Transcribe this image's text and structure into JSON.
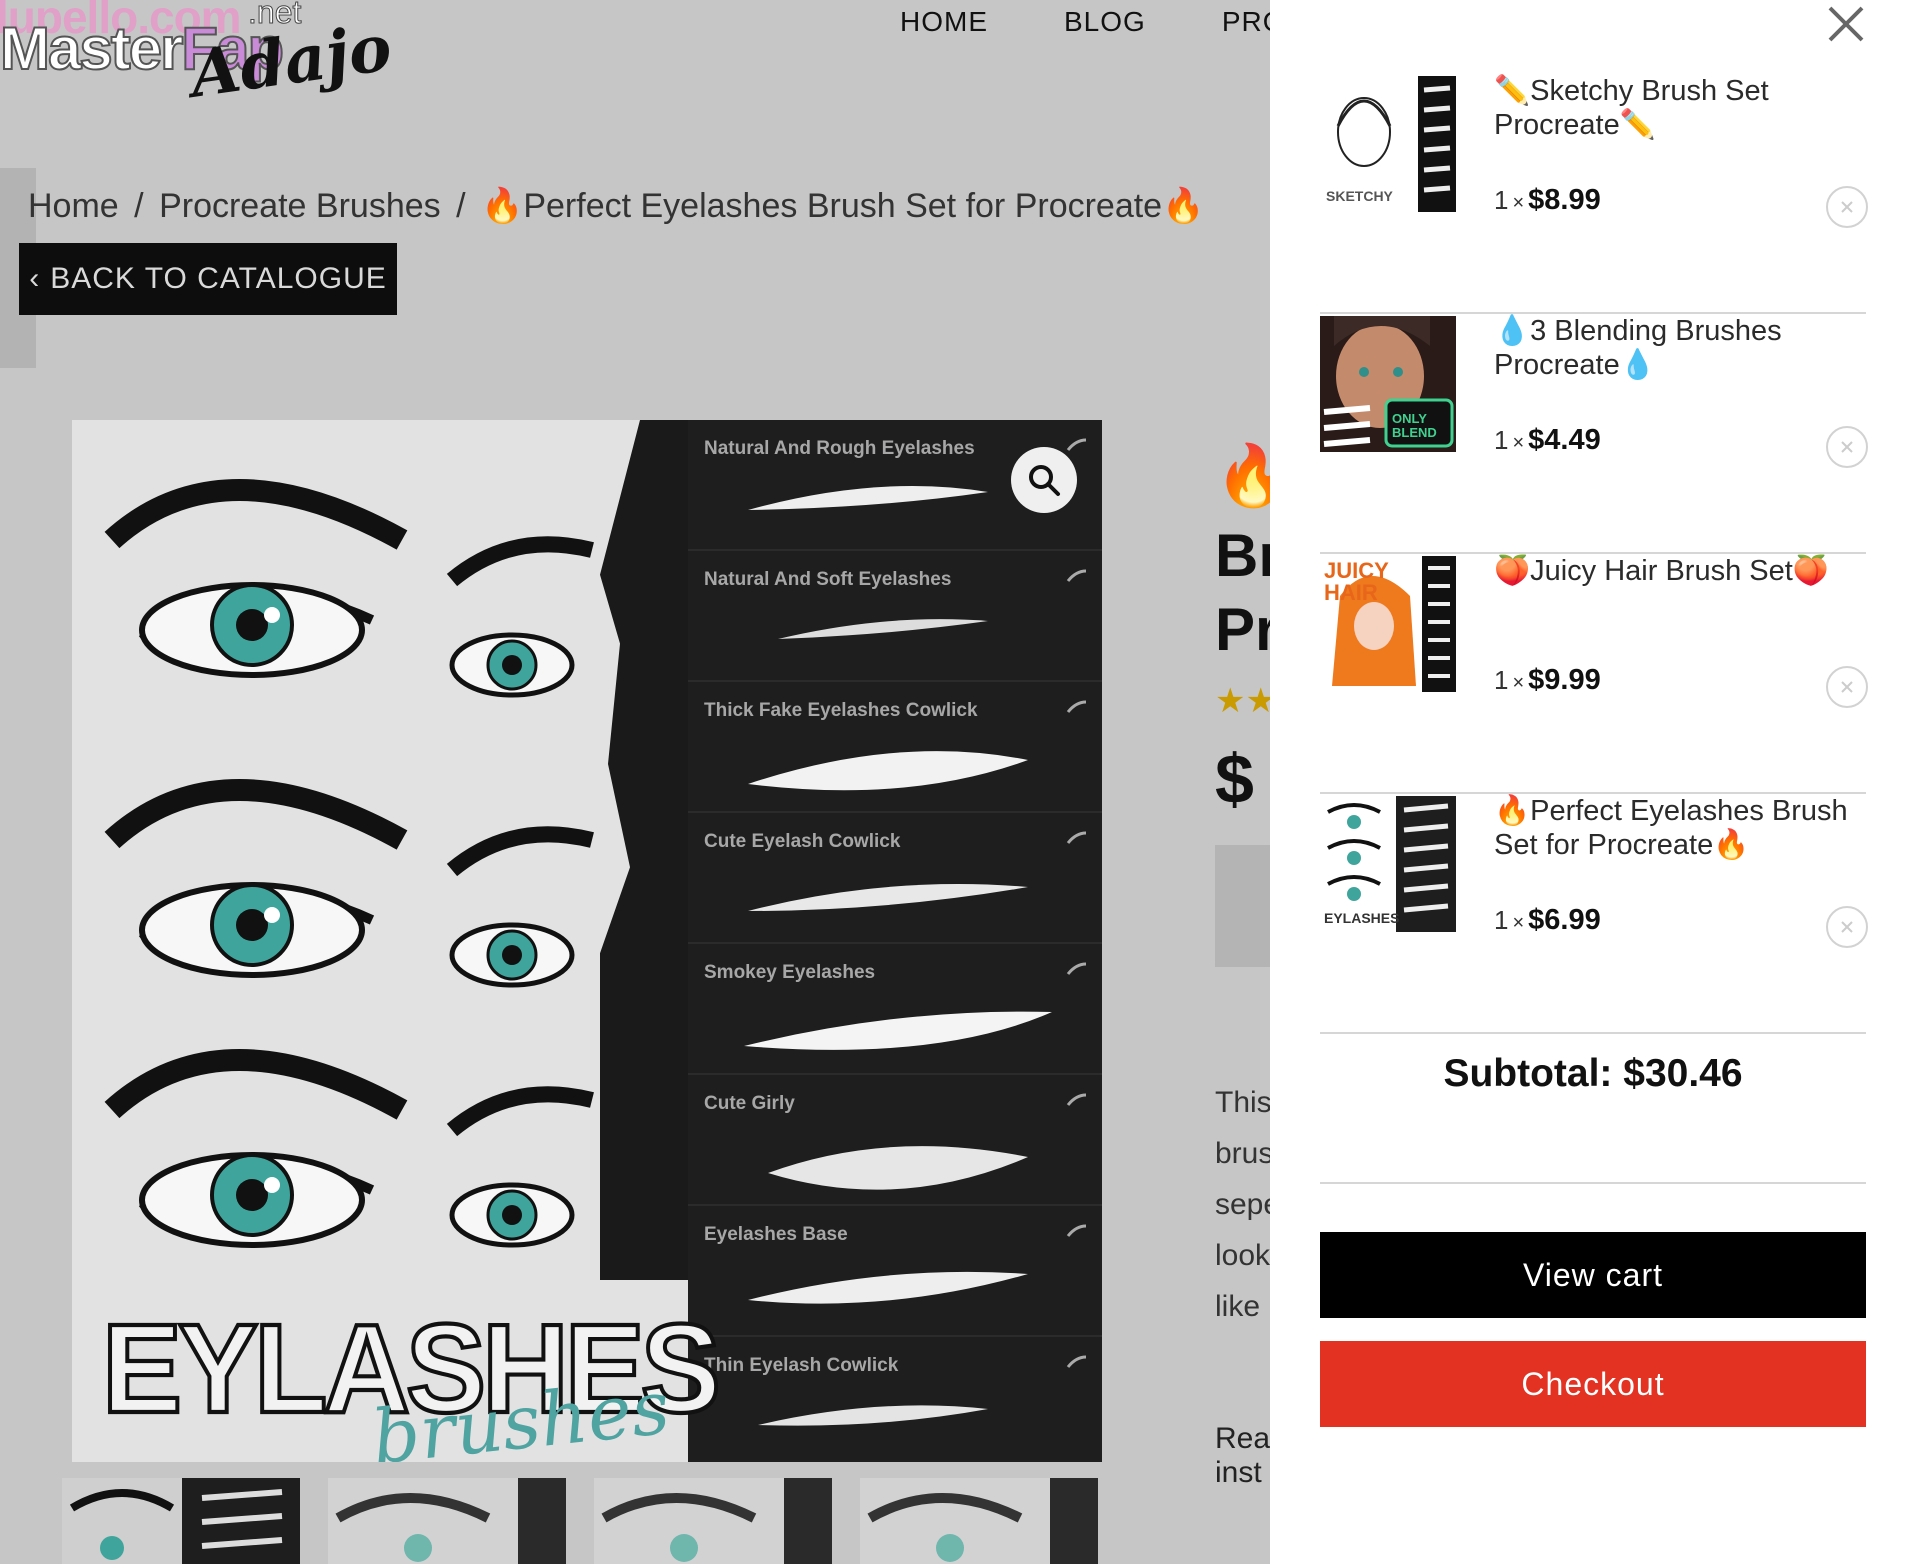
{
  "site": {
    "logo_top": "lupello.com",
    "logo_master": "Master",
    "logo_fap": "Fap",
    "logo_net": ".net",
    "logo_signature": "Adajo"
  },
  "nav": [
    "HOME",
    "BLOG",
    "PRO"
  ],
  "breadcrumb": {
    "home": "Home",
    "category": "Procreate Brushes",
    "current": "🔥Perfect Eyelashes Brush Set for Procreate🔥",
    "separator": "/"
  },
  "back_button": {
    "chevron": "‹",
    "label": "BACK TO CATALOGUE"
  },
  "product_image": {
    "brushes": [
      "Natural And Rough Eyelashes",
      "Natural And Soft Eyelashes",
      "Thick Fake Eyelashes Cowlick",
      "Cute Eyelash Cowlick",
      "Smokey Eyelashes",
      "Cute Girly",
      "Eyelashes Base",
      "Thin Eyelash Cowlick"
    ],
    "big_text": "EYLASHES",
    "script_text": "brushes",
    "zoom_icon": "search-icon"
  },
  "summary": {
    "fire": "🔥",
    "title_line1": "Br",
    "title_line2": "Pr",
    "stars": "★★",
    "price": "$",
    "desc_lines": [
      "This",
      "brus",
      "sepe",
      "look",
      "like"
    ],
    "read_more": "Rea",
    "read_more_2": "inst"
  },
  "cart": {
    "close_icon": "close-icon",
    "items": [
      {
        "name": "✏️Sketchy Brush Set Procreate✏️",
        "qty": "1",
        "times": "×",
        "price": "$8.99",
        "thumb_label": "SKETCHY"
      },
      {
        "name": "💧3 Blending Brushes Procreate💧",
        "qty": "1",
        "times": "×",
        "price": "$4.49",
        "thumb_label": "ONLY BLEND"
      },
      {
        "name": "🍑Juicy Hair Brush Set🍑",
        "qty": "1",
        "times": "×",
        "price": "$9.99",
        "thumb_label": "JUICY HAIR"
      },
      {
        "name": "🔥Perfect Eyelashes Brush Set for Procreate🔥",
        "qty": "1",
        "times": "×",
        "price": "$6.99",
        "thumb_label": "EYLASHES"
      }
    ],
    "subtotal_label": "Subtotal:",
    "subtotal_value": "$30.46",
    "view_cart": "View cart",
    "checkout": "Checkout"
  },
  "colors": {
    "checkout_red": "#e33122",
    "button_black": "#000000",
    "accent_teal": "#4fa3a1"
  }
}
